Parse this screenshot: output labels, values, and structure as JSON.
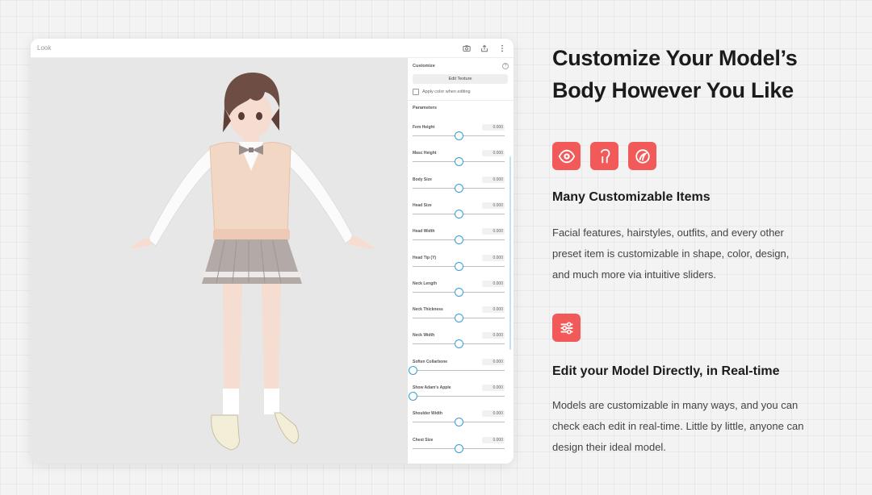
{
  "window": {
    "title": "Look",
    "actions": [
      {
        "icon": "camera-icon"
      },
      {
        "icon": "share-icon"
      },
      {
        "icon": "more-vertical-icon"
      }
    ]
  },
  "panel": {
    "customize_title": "Customize",
    "help_icon": "help-icon",
    "edit_texture_label": "Edit Texture",
    "apply_color_label": "Apply color when editing",
    "apply_color_checked": false,
    "parameters_title": "Parameters",
    "params": [
      {
        "label": "Fem Height",
        "value": "0.000",
        "slider": 0.5
      },
      {
        "label": "Masc Height",
        "value": "0.000",
        "slider": 0.5
      },
      {
        "label": "Body Size",
        "value": "0.000",
        "slider": 0.5
      },
      {
        "label": "Head Size",
        "value": "0.000",
        "slider": 0.5
      },
      {
        "label": "Head Width",
        "value": "0.000",
        "slider": 0.5
      },
      {
        "label": "Head Tip (Y)",
        "value": "0.000",
        "slider": 0.5
      },
      {
        "label": "Neck Length",
        "value": "0.000",
        "slider": 0.5
      },
      {
        "label": "Neck Thickness",
        "value": "0.000",
        "slider": 0.5
      },
      {
        "label": "Neck Width",
        "value": "0.000",
        "slider": 0.5
      },
      {
        "label": "Soften Collarbone",
        "value": "0.000",
        "slider": 0.0
      },
      {
        "label": "Show Adam's Apple",
        "value": "0.000",
        "slider": 0.0
      },
      {
        "label": "Shoulder Width",
        "value": "0.000",
        "slider": 0.5
      },
      {
        "label": "Chest Size",
        "value": "0.000",
        "slider": 0.5
      }
    ]
  },
  "content": {
    "headline_line1": "Customize Your Model’s",
    "headline_line2": "Body However You Like",
    "feature1": {
      "icons": [
        "eye-icon",
        "hairstyle-icon",
        "face-shape-icon"
      ],
      "title": "Many Customizable Items",
      "line1": "Facial features, hairstyles, outfits, and every other",
      "line2": "preset item is customizable in shape, color, design,",
      "line3": "and much more via intuitive sliders."
    },
    "feature2": {
      "icon": "sliders-icon",
      "title": "Edit your Model Directly, in Real-time",
      "line1": "Models are customizable in many ways, and you can",
      "line2": "check each edit in real-time. Little by little, anyone can",
      "line3": "design their ideal model."
    }
  },
  "colors": {
    "accent": "#f25a5a",
    "slider_thumb": "#3a9bd4",
    "background": "#f3f3f3"
  }
}
